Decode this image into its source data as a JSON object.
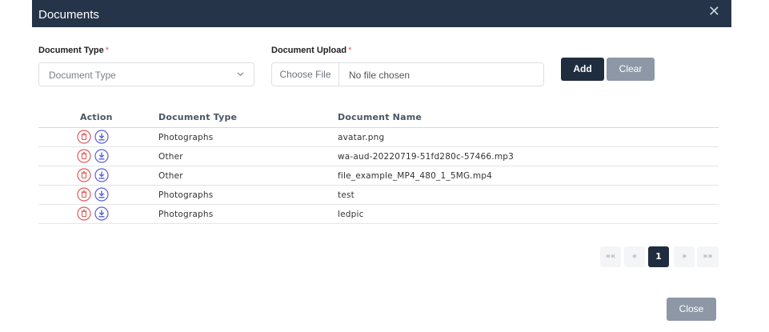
{
  "modal": {
    "title": "Documents",
    "close_glyph": "✕"
  },
  "form": {
    "doc_type_label": "Document Type",
    "doc_upload_label": "Document Upload",
    "required_mark": "*",
    "doc_type_value": "Document Type",
    "choose_file_label": "Choose File",
    "file_status": "No file chosen",
    "add_label": "Add",
    "clear_label": "Clear"
  },
  "table": {
    "headers": [
      "Action",
      "Document Type",
      "Document Name"
    ],
    "rows": [
      {
        "type": "Photographs",
        "name": "avatar.png"
      },
      {
        "type": "Other",
        "name": "wa-aud-20220719-51fd280c-57466.mp3"
      },
      {
        "type": "Other",
        "name": "file_example_MP4_480_1_5MG.mp4"
      },
      {
        "type": "Photographs",
        "name": "test"
      },
      {
        "type": "Photographs",
        "name": "ledpic"
      }
    ],
    "row_icons": [
      "trash-icon",
      "download-icon"
    ]
  },
  "pagination": {
    "first": "««",
    "prev": "«",
    "current": "1",
    "next": "»",
    "last": "»»"
  },
  "footer": {
    "close_label": "Close"
  },
  "colors": {
    "header_bg": "#253448",
    "primary": "#1f2d3f",
    "secondary": "#8d97a5",
    "delete": "#e05a5a",
    "download": "#5b5fd6"
  }
}
